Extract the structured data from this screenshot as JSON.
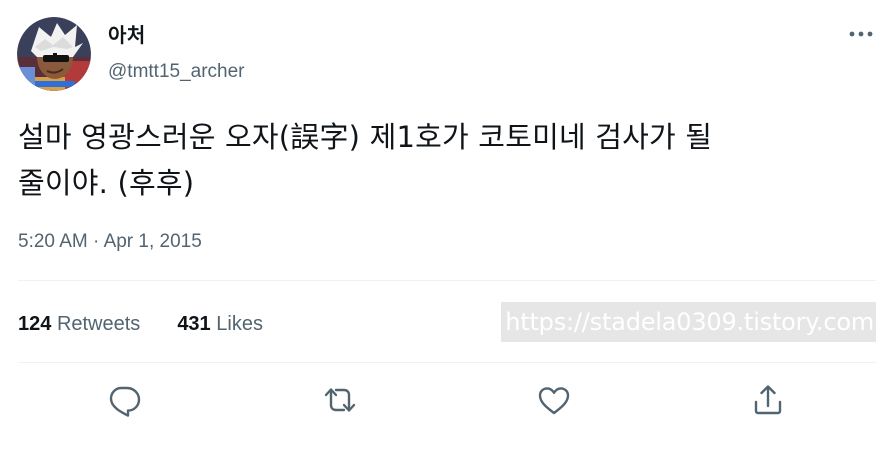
{
  "author": {
    "display_name": "아처",
    "handle": "@tmtt15_archer",
    "avatar_icon": "avatar-image"
  },
  "more_icon": "more-horizontal-icon",
  "tweet": {
    "line1": "설마 영광스러운 오자(誤字) 제1호가 코토미네 검사가 될",
    "line2": "줄이야. (후후)",
    "time": "5:20 AM",
    "separator": " · ",
    "date": "Apr 1, 2015"
  },
  "stats": {
    "retweets_count": "124",
    "retweets_label": "Retweets",
    "likes_count": "431",
    "likes_label": "Likes"
  },
  "watermark": "https://stadela0309.tistory.com",
  "actions": {
    "reply_icon": "reply-icon",
    "retweet_icon": "retweet-icon",
    "like_icon": "heart-icon",
    "share_icon": "share-icon"
  },
  "colors": {
    "text": "#0f1419",
    "secondary": "#536471",
    "divider": "#eff3f4",
    "watermark_bg": "#e6e6e6"
  }
}
